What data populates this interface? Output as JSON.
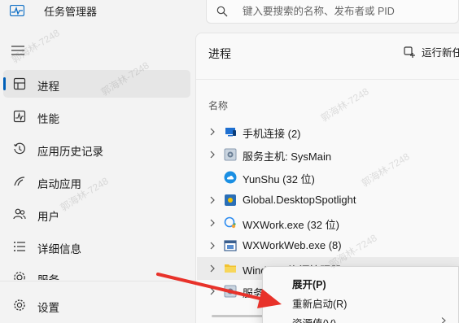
{
  "app": {
    "title": "任务管理器"
  },
  "search": {
    "placeholder": "键入要搜索的名称、发布者或 PID"
  },
  "sidebar": {
    "items": [
      {
        "label": "进程",
        "icon": "processes-icon"
      },
      {
        "label": "性能",
        "icon": "performance-icon"
      },
      {
        "label": "应用历史记录",
        "icon": "history-icon"
      },
      {
        "label": "启动应用",
        "icon": "startup-icon"
      },
      {
        "label": "用户",
        "icon": "users-icon"
      },
      {
        "label": "详细信息",
        "icon": "details-icon"
      },
      {
        "label": "服务",
        "icon": "services-icon"
      }
    ],
    "settings_label": "设置"
  },
  "main": {
    "title": "进程",
    "run_task_label": "运行新任",
    "column_header": "名称",
    "rows": [
      {
        "name": "手机连接 (2)",
        "icon": "phone-link-icon",
        "expandable": true
      },
      {
        "name": "服务主机: SysMain",
        "icon": "service-host-icon",
        "expandable": true
      },
      {
        "name": "YunShu (32 位)",
        "icon": "cloud-icon",
        "expandable": false
      },
      {
        "name": "Global.DesktopSpotlight",
        "icon": "spotlight-icon",
        "expandable": true
      },
      {
        "name": "WXWork.exe (32 位)",
        "icon": "wxwork-icon",
        "expandable": true
      },
      {
        "name": "WXWorkWeb.exe (8)",
        "icon": "window-icon",
        "expandable": true
      },
      {
        "name": "Windows 资源管理器",
        "icon": "folder-icon",
        "expandable": true
      },
      {
        "name": "服务",
        "icon": "gear-icon",
        "expandable": true
      }
    ]
  },
  "context_menu": {
    "items": [
      {
        "label": "展开(P)"
      },
      {
        "label": "重新启动(R)"
      },
      {
        "label": "资源值(V)"
      }
    ]
  },
  "watermark": "郭海林-7248",
  "colors": {
    "accent": "#005fb8",
    "arrow": "#e8322a"
  }
}
